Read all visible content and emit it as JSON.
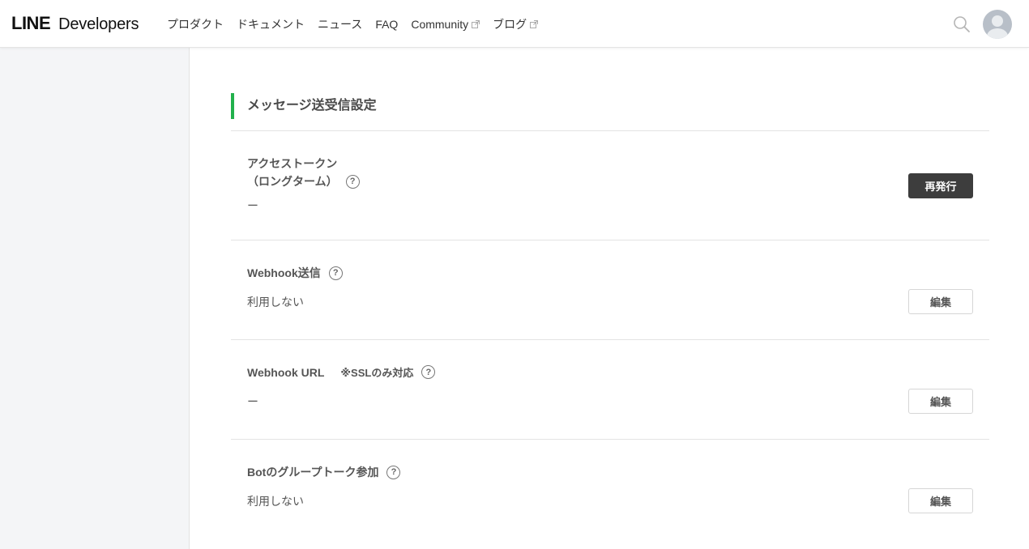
{
  "header": {
    "logo_primary": "LINE",
    "logo_secondary": "Developers",
    "nav": [
      {
        "label": "プロダクト",
        "external": false
      },
      {
        "label": "ドキュメント",
        "external": false
      },
      {
        "label": "ニュース",
        "external": false
      },
      {
        "label": "FAQ",
        "external": false
      },
      {
        "label": "Community",
        "external": true
      },
      {
        "label": "ブログ",
        "external": true
      }
    ],
    "search_icon": "search-icon",
    "avatar_icon": "user-avatar-icon"
  },
  "section": {
    "title": "メッセージ送受信設定",
    "accent_color": "#22b14c"
  },
  "settings": {
    "access_token": {
      "label_line1": "アクセストークン",
      "label_line2": "（ロングターム）",
      "value": "ー",
      "button": "再発行"
    },
    "webhook_send": {
      "label": "Webhook送信",
      "value": "利用しない",
      "button": "編集"
    },
    "webhook_url": {
      "label": "Webhook URL",
      "note": "※SSLのみ対応",
      "value": "ー",
      "button": "編集"
    },
    "bot_group": {
      "label": "Botのグループトーク参加",
      "value": "利用しない",
      "button": "編集"
    }
  },
  "help_glyph": "?"
}
